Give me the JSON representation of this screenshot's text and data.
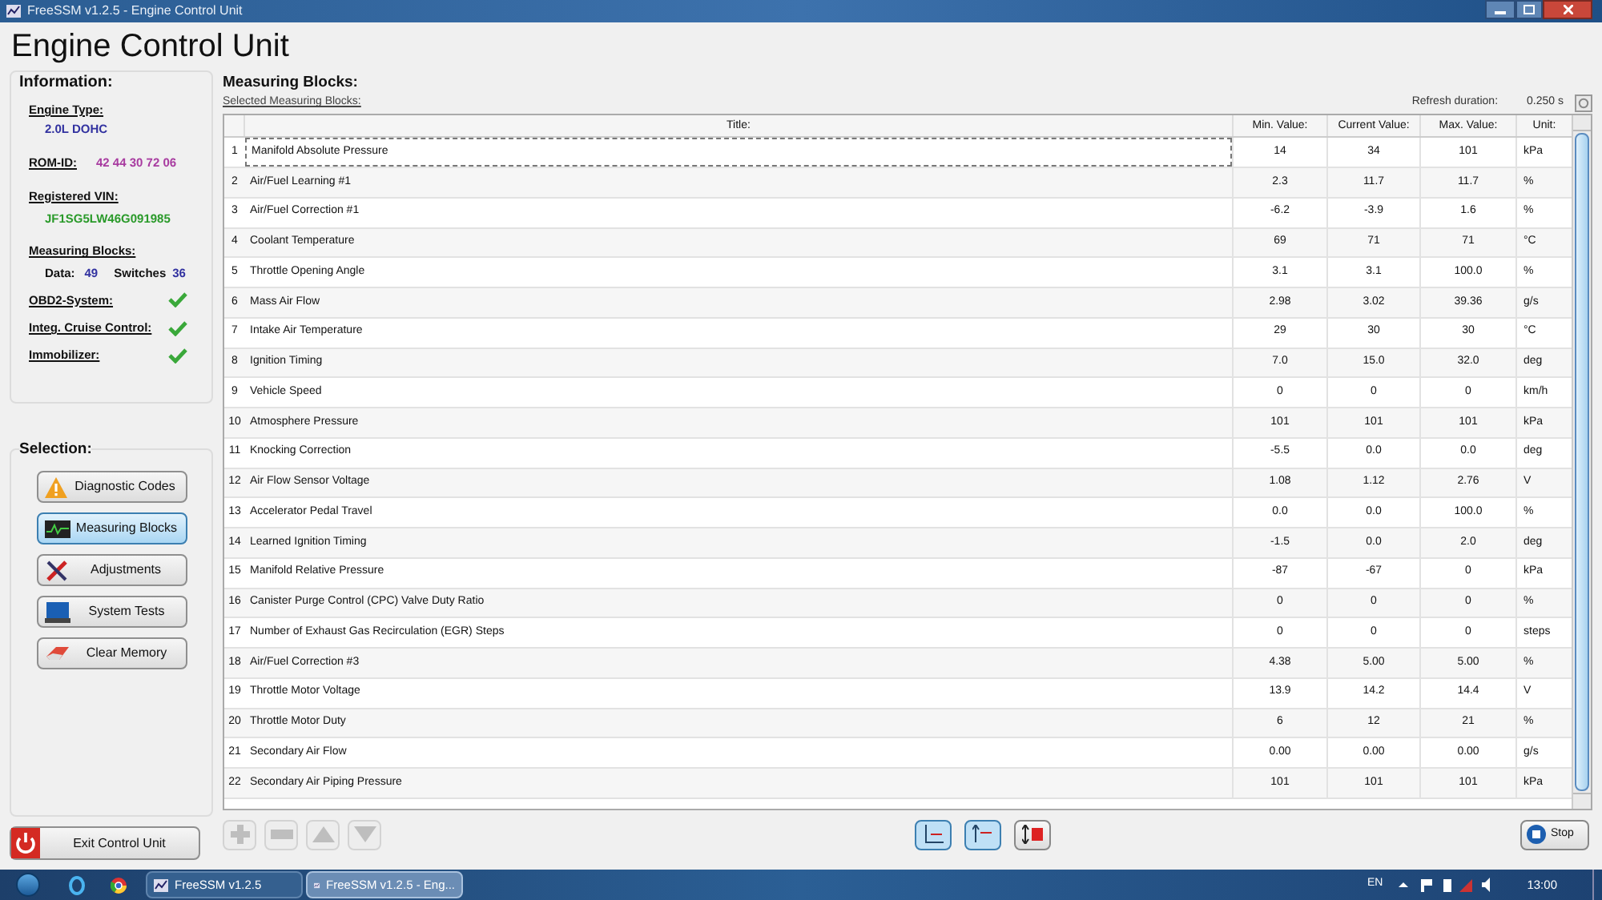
{
  "window": {
    "title": "FreeSSM v1.2.5 - Engine Control Unit"
  },
  "heading": "Engine Control Unit",
  "information": {
    "title": "Information:",
    "engine_type_label": "Engine Type:",
    "engine_type": "2.0L DOHC",
    "rom_id_label": "ROM-ID:",
    "rom_id": "42 44 30 72 06",
    "vin_label": "Registered VIN:",
    "vin": "JF1SG5LW46G091985",
    "blocks_label": "Measuring Blocks:",
    "data_label": "Data:",
    "data_count": "49",
    "switches_label": "Switches",
    "switches_count": "36",
    "features": [
      {
        "label": "OBD2-System:",
        "supported": true
      },
      {
        "label": "Integ. Cruise Control:",
        "supported": true
      },
      {
        "label": "Immobilizer:",
        "supported": true
      }
    ]
  },
  "selection": {
    "title": "Selection:",
    "buttons": [
      {
        "label": "Diagnostic Codes",
        "kind": "warning",
        "selected": false
      },
      {
        "label": "Measuring Blocks",
        "kind": "monitor",
        "selected": true
      },
      {
        "label": "Adjustments",
        "kind": "tools",
        "selected": false
      },
      {
        "label": "System Tests",
        "kind": "laptop",
        "selected": false
      },
      {
        "label": "Clear Memory",
        "kind": "eraser",
        "selected": false
      }
    ]
  },
  "exit_button": "Exit Control Unit",
  "measuring": {
    "title": "Measuring Blocks:",
    "subtitle": "Selected Measuring Blocks:",
    "refresh_label": "Refresh duration:",
    "refresh_value": "0.250 s",
    "columns": [
      "Title:",
      "Min. Value:",
      "Current Value:",
      "Max. Value:",
      "Unit:"
    ],
    "rows": [
      {
        "n": "1",
        "title": "Manifold Absolute Pressure",
        "min": "14",
        "cur": "34",
        "max": "101",
        "unit": "kPa",
        "selected": true
      },
      {
        "n": "2",
        "title": "Air/Fuel Learning #1",
        "min": "2.3",
        "cur": "11.7",
        "max": "11.7",
        "unit": "%",
        "selected": false
      },
      {
        "n": "3",
        "title": "Air/Fuel Correction #1",
        "min": "-6.2",
        "cur": "-3.9",
        "max": "1.6",
        "unit": "%",
        "selected": false
      },
      {
        "n": "4",
        "title": "Coolant Temperature",
        "min": "69",
        "cur": "71",
        "max": "71",
        "unit": "°C",
        "selected": false
      },
      {
        "n": "5",
        "title": "Throttle Opening Angle",
        "min": "3.1",
        "cur": "3.1",
        "max": "100.0",
        "unit": "%",
        "selected": false
      },
      {
        "n": "6",
        "title": "Mass Air Flow",
        "min": "2.98",
        "cur": "3.02",
        "max": "39.36",
        "unit": "g/s",
        "selected": false
      },
      {
        "n": "7",
        "title": "Intake Air Temperature",
        "min": "29",
        "cur": "30",
        "max": "30",
        "unit": "°C",
        "selected": false
      },
      {
        "n": "8",
        "title": "Ignition Timing",
        "min": "7.0",
        "cur": "15.0",
        "max": "32.0",
        "unit": "deg",
        "selected": false
      },
      {
        "n": "9",
        "title": "Vehicle Speed",
        "min": "0",
        "cur": "0",
        "max": "0",
        "unit": "km/h",
        "selected": false
      },
      {
        "n": "10",
        "title": "Atmosphere Pressure",
        "min": "101",
        "cur": "101",
        "max": "101",
        "unit": "kPa",
        "selected": false
      },
      {
        "n": "11",
        "title": "Knocking Correction",
        "min": "-5.5",
        "cur": "0.0",
        "max": "0.0",
        "unit": "deg",
        "selected": false
      },
      {
        "n": "12",
        "title": "Air Flow Sensor Voltage",
        "min": "1.08",
        "cur": "1.12",
        "max": "2.76",
        "unit": "V",
        "selected": false
      },
      {
        "n": "13",
        "title": "Accelerator Pedal Travel",
        "min": "0.0",
        "cur": "0.0",
        "max": "100.0",
        "unit": "%",
        "selected": false
      },
      {
        "n": "14",
        "title": "Learned Ignition Timing",
        "min": "-1.5",
        "cur": "0.0",
        "max": "2.0",
        "unit": "deg",
        "selected": false
      },
      {
        "n": "15",
        "title": "Manifold Relative Pressure",
        "min": "-87",
        "cur": "-67",
        "max": "0",
        "unit": "kPa",
        "selected": false
      },
      {
        "n": "16",
        "title": "Canister Purge Control (CPC) Valve Duty Ratio",
        "min": "0",
        "cur": "0",
        "max": "0",
        "unit": "%",
        "selected": false
      },
      {
        "n": "17",
        "title": "Number of Exhaust Gas Recirculation (EGR) Steps",
        "min": "0",
        "cur": "0",
        "max": "0",
        "unit": "steps",
        "selected": false
      },
      {
        "n": "18",
        "title": "Air/Fuel Correction #3",
        "min": "4.38",
        "cur": "5.00",
        "max": "5.00",
        "unit": "%",
        "selected": false
      },
      {
        "n": "19",
        "title": "Throttle Motor Voltage",
        "min": "13.9",
        "cur": "14.2",
        "max": "14.4",
        "unit": "V",
        "selected": false
      },
      {
        "n": "20",
        "title": "Throttle Motor Duty",
        "min": "6",
        "cur": "12",
        "max": "21",
        "unit": "%",
        "selected": false
      },
      {
        "n": "21",
        "title": "Secondary Air Flow",
        "min": "0.00",
        "cur": "0.00",
        "max": "0.00",
        "unit": "g/s",
        "selected": false
      },
      {
        "n": "22",
        "title": "Secondary Air Piping Pressure",
        "min": "101",
        "cur": "101",
        "max": "101",
        "unit": "kPa",
        "selected": false
      }
    ],
    "edit_buttons": [
      {
        "kind": "add",
        "disabled": true
      },
      {
        "kind": "remove",
        "disabled": true
      },
      {
        "kind": "up",
        "disabled": true
      },
      {
        "kind": "down",
        "disabled": true
      }
    ],
    "mode_buttons": [
      {
        "kind": "min",
        "pressed": true
      },
      {
        "kind": "max",
        "pressed": true
      },
      {
        "kind": "reset",
        "pressed": false
      }
    ],
    "stop_button": "Stop"
  },
  "taskbar": {
    "tasks": [
      {
        "label": "FreeSSM v1.2.5",
        "selected": false
      },
      {
        "label": "FreeSSM v1.2.5 - Eng...",
        "selected": true
      }
    ],
    "language": "EN",
    "time": "13:00"
  }
}
